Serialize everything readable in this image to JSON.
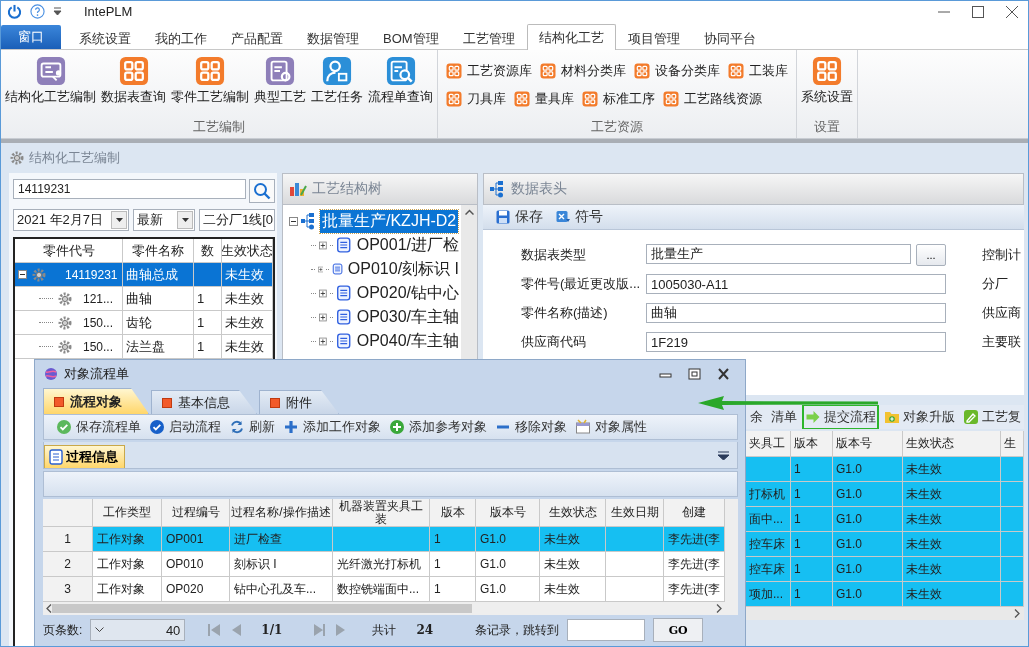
{
  "app": {
    "title": "IntePLM"
  },
  "window_button": "窗口",
  "menu_tabs": [
    {
      "label": "系统设置",
      "selected": false
    },
    {
      "label": "我的工作",
      "selected": false
    },
    {
      "label": "产品配置",
      "selected": false
    },
    {
      "label": "数据管理",
      "selected": false
    },
    {
      "label": "BOM管理",
      "selected": false
    },
    {
      "label": "工艺管理",
      "selected": false
    },
    {
      "label": "结构化工艺",
      "selected": true
    },
    {
      "label": "项目管理",
      "selected": false
    },
    {
      "label": "协同平台",
      "selected": false
    }
  ],
  "ribbon": [
    {
      "title": "工艺编制",
      "buttons": [
        {
          "label": "结构化工艺编制",
          "kind": "flow"
        },
        {
          "label": "数据表查询",
          "kind": "grid"
        },
        {
          "label": "零件工艺编制",
          "kind": "grid"
        },
        {
          "label": "典型工艺",
          "kind": "gear-doc"
        },
        {
          "label": "工艺任务",
          "kind": "user"
        },
        {
          "label": "流程单查询",
          "kind": "search-doc"
        }
      ]
    },
    {
      "title": "工艺资源",
      "rows": [
        {
          "items": [
            "工艺资源库",
            "材料分类库",
            "设备分类库",
            "工装库"
          ]
        },
        {
          "items": [
            "刀具库",
            "量具库",
            "标准工序",
            "工艺路线资源"
          ]
        }
      ]
    },
    {
      "title": "设置",
      "buttons": [
        {
          "label": "系统设置",
          "kind": "grid"
        }
      ]
    }
  ],
  "workspace": {
    "title": "结构化工艺编制"
  },
  "parts_panel": {
    "search": {
      "value": "14119231"
    },
    "date": "2021 年2月7日",
    "version": "最新",
    "line": "二分厂1线[0",
    "columns": [
      "零件代号",
      "零件名称",
      "数",
      "生效状态"
    ],
    "rows": [
      {
        "code": "14119231",
        "name": "曲轴总成",
        "status": "未生效",
        "selected": true,
        "expanded": true,
        "children": [
          {
            "code": "121...",
            "name": "曲轴",
            "qty": "1",
            "status": "未生效",
            "selected": false
          },
          {
            "code": "150...",
            "name": "齿轮",
            "qty": "1",
            "status": "未生效",
            "selected": false
          },
          {
            "code": "150...",
            "name": "法兰盘",
            "qty": "1",
            "status": "未生效",
            "selected": false
          }
        ]
      }
    ]
  },
  "process_tree": {
    "title": "工艺结构树",
    "root": {
      "label": "批量生产/KZJH-D2",
      "selected": true,
      "expanded": true,
      "children": [
        {
          "label": "OP001/进厂检",
          "expanded": false
        },
        {
          "label": "OP010/刻标识 I",
          "expanded": false
        },
        {
          "label": "OP020/钻中心",
          "expanded": false
        },
        {
          "label": "OP030/车主轴",
          "expanded": false
        },
        {
          "label": "OP040/车主轴",
          "expanded": false
        }
      ]
    }
  },
  "data_header": {
    "title": "数据表头",
    "tools": [
      {
        "label": "保存",
        "kind": "floppy"
      },
      {
        "label": "符号",
        "kind": "symbol"
      }
    ],
    "fields": [
      {
        "label": "数据表类型",
        "value": "批量生产",
        "picker": "..."
      },
      {
        "label": "零件号(最近更改版...",
        "value": "1005030-A11"
      },
      {
        "label": "零件名称(描述)",
        "value": "曲轴"
      },
      {
        "label": "供应商代码",
        "value": "1F219"
      }
    ],
    "side_labels": [
      "控制计",
      "分厂",
      "供应商",
      "主要联"
    ]
  },
  "back_toolbar": [
    {
      "label": "余",
      "kind": "text",
      "highlighted": false
    },
    {
      "label": "清单",
      "kind": "text",
      "highlighted": false
    },
    {
      "label": "提交流程",
      "kind": "arrow",
      "highlighted": true
    },
    {
      "label": "对象升版",
      "kind": "folder",
      "highlighted": false
    },
    {
      "label": "工艺复",
      "kind": "craft",
      "highlighted": false
    }
  ],
  "back_grid": {
    "columns": [
      "夹具工",
      "版本",
      "版本号",
      "生效状态",
      "生"
    ],
    "rows": [
      {
        "version": "1",
        "revision": "G1.0",
        "status": "未生效",
        "selected": true
      },
      {
        "tool": "打标机",
        "version": "1",
        "revision": "G1.0",
        "status": "未生效",
        "selected": true
      },
      {
        "tool": "面中...",
        "version": "1",
        "revision": "G1.0",
        "status": "未生效",
        "selected": true
      },
      {
        "tool": "控车床",
        "version": "1",
        "revision": "G1.0",
        "status": "未生效",
        "selected": true
      },
      {
        "tool": "控车床",
        "version": "1",
        "revision": "G1.0",
        "status": "未生效",
        "selected": true
      },
      {
        "tool": "项加...",
        "version": "1",
        "revision": "G1.0",
        "status": "未生效",
        "selected": true
      }
    ]
  },
  "dialog": {
    "title": "对象流程单",
    "tabs": [
      {
        "label": "流程对象",
        "selected": true
      },
      {
        "label": "基本信息",
        "selected": false
      },
      {
        "label": "附件",
        "selected": false
      }
    ],
    "tools": [
      {
        "label": "保存流程单",
        "kind": "save"
      },
      {
        "label": "启动流程",
        "kind": "start"
      },
      {
        "label": "刷新",
        "kind": "refresh"
      },
      {
        "label": "添加工作对象",
        "kind": "add"
      },
      {
        "label": "添加参考对象",
        "kind": "add-ref"
      },
      {
        "label": "移除对象",
        "kind": "remove"
      },
      {
        "label": "对象属性",
        "kind": "props"
      }
    ],
    "subtabs": [
      {
        "label": "过程信息",
        "selected": true
      }
    ],
    "grid": {
      "columns": [
        "工作类型",
        "过程编号",
        "过程名称/操作描述",
        "机器装置夹具工装",
        "版本",
        "版本号",
        "生效状态",
        "生效日期",
        "创建"
      ],
      "rows": [
        {
          "index": "1",
          "type": "工作对象",
          "code": "OP001",
          "name": "进厂检查",
          "version": "1",
          "revision": "G1.0",
          "status": "未生效",
          "creator": "李先进(李",
          "selected": true
        },
        {
          "index": "2",
          "type": "工作对象",
          "code": "OP010",
          "name": "刻标识 I",
          "machine": "光纤激光打标机",
          "version": "1",
          "revision": "G1.0",
          "status": "未生效",
          "creator": "李先进(李",
          "selected": false
        },
        {
          "index": "3",
          "type": "工作对象",
          "code": "OP020",
          "name": "钻中心孔及车...",
          "machine": "数控铣端面中...",
          "version": "1",
          "revision": "G1.0",
          "status": "未生效",
          "creator": "李先进(李",
          "selected": false
        }
      ]
    },
    "pager": {
      "size_label": "页条数:",
      "size": "40",
      "page": "1/1",
      "total_label": "共计",
      "total": "24",
      "jump_label": "条记录，跳转到",
      "go": "GO"
    }
  }
}
